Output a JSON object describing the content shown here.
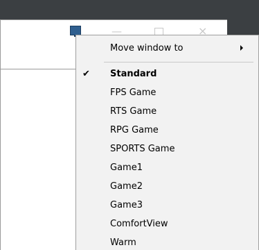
{
  "window": {
    "controls": {
      "minimize": "—",
      "close": "×"
    }
  },
  "menu": {
    "move_window_label": "Move window to",
    "check_mark": "✔",
    "items": [
      {
        "label": "Standard",
        "checked": true,
        "bold": true
      },
      {
        "label": "FPS Game",
        "checked": false
      },
      {
        "label": "RTS Game",
        "checked": false
      },
      {
        "label": "RPG Game",
        "checked": false
      },
      {
        "label": "SPORTS Game",
        "checked": false
      },
      {
        "label": "Game1",
        "checked": false
      },
      {
        "label": "Game2",
        "checked": false
      },
      {
        "label": "Game3",
        "checked": false
      },
      {
        "label": "ComfortView",
        "checked": false
      },
      {
        "label": "Warm",
        "checked": false
      }
    ]
  },
  "colors": {
    "desktop": "#3b3f42",
    "menu_bg": "#f2f2f2",
    "menu_border": "#a0a0a0"
  }
}
